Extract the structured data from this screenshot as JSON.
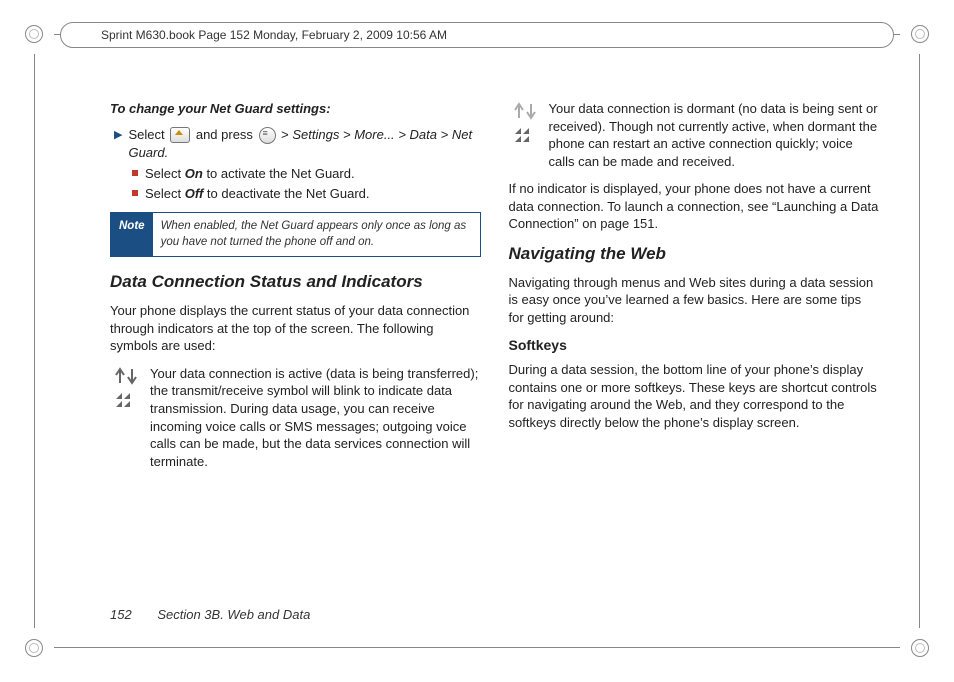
{
  "header": {
    "running": "Sprint M630.book  Page 152  Monday, February 2, 2009  10:56 AM"
  },
  "left": {
    "changeTitle": "To change your Net Guard settings:",
    "step1_a": "Select ",
    "step1_b": " and press ",
    "step1_c": " > ",
    "nav": {
      "settings": "Settings",
      "more": "More...",
      "data": "Data",
      "netguard": "Net Guard."
    },
    "sub1_a": "Select ",
    "sub1_on": "On",
    "sub1_b": " to activate the Net Guard.",
    "sub2_a": "Select ",
    "sub2_off": "Off",
    "sub2_b": " to deactivate the Net Guard.",
    "note": {
      "label": "Note",
      "text": "When enabled, the Net Guard appears only once as long as you have not turned the phone off and on."
    },
    "secTitle": "Data Connection Status and Indicators",
    "intro": "Your phone displays the current status of your data connection through indicators at the top of the screen. The following symbols are used:",
    "activeDesc": "Your data connection is active (data is being transferred); the transmit/receive symbol will blink to indicate data transmission. During data usage, you can receive incoming voice calls or SMS messages; outgoing voice calls can be made, but the data services connection will terminate."
  },
  "right": {
    "dormantDesc": "Your data connection is dormant (no data is being sent or received). Though not currently active, when dormant the phone can restart an active connection quickly; voice calls can be made and received.",
    "noIndicator": "If no indicator is displayed, your phone does not have a current data connection. To launch a connection, see “Launching a Data Connection” on page 151.",
    "navTitle": "Navigating the Web",
    "navIntro": "Navigating through menus and Web sites during a data session is easy once you’ve learned a few basics. Here are some tips for getting around:",
    "softkeysTitle": "Softkeys",
    "softkeysBody": "During a data session, the bottom line of your phone’s display contains one or more softkeys. These keys are shortcut controls for navigating around the Web, and they correspond to the softkeys directly below the phone’s display screen."
  },
  "footer": {
    "page": "152",
    "section": "Section 3B. Web and Data"
  }
}
